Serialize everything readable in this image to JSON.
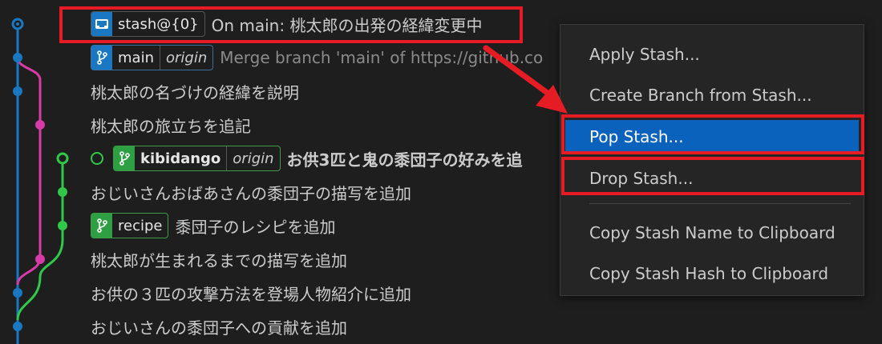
{
  "rows": [
    {
      "badge": {
        "name": "stash@{0}",
        "icon": "stash-icon"
      },
      "message": "On main: 桃太郎の出発の経緯変更中"
    },
    {
      "badge": {
        "name": "main",
        "remote": "origin",
        "icon": "branch-icon"
      },
      "message": "Merge branch 'main' of https://github.co"
    },
    {
      "message": "桃太郎の名づけの経緯を説明"
    },
    {
      "message": "桃太郎の旅立ちを追記"
    },
    {
      "badge": {
        "name": "kibidango",
        "remote": "origin",
        "icon": "branch-icon"
      },
      "message": "お供3匹と鬼の黍団子の好みを追"
    },
    {
      "message": "おじいさんおばあさんの黍団子の描写を追加"
    },
    {
      "badge": {
        "name": "recipe",
        "icon": "branch-icon"
      },
      "message": "黍団子のレシピを追加"
    },
    {
      "message": "桃太郎が生まれるまでの描写を追加"
    },
    {
      "message": "お供の３匹の攻撃方法を登場人物紹介に追加"
    },
    {
      "message": "おじいさんの黍団子への貢献を追加"
    }
  ],
  "context_menu": {
    "items": [
      {
        "label": "Apply Stash..."
      },
      {
        "label": "Create Branch from Stash..."
      },
      {
        "label": "Pop Stash...",
        "active": true
      },
      {
        "label": "Drop Stash..."
      },
      {
        "label": "Copy Stash Name to Clipboard"
      },
      {
        "label": "Copy Stash Hash to Clipboard"
      }
    ]
  },
  "colors": {
    "graph_blue": "#1a78c2",
    "graph_pink": "#d63ba8",
    "graph_green": "#31c84a",
    "highlight_red": "#e51c23",
    "menu_active": "#0a62bd"
  }
}
